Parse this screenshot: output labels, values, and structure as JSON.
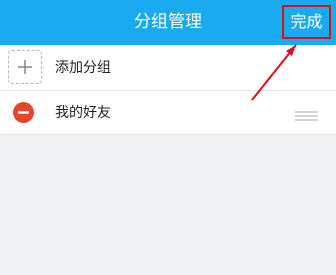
{
  "header": {
    "title": "分组管理",
    "done_label": "完成"
  },
  "groups": {
    "add_label": "添加分组",
    "items": [
      {
        "label": "我的好友"
      }
    ]
  },
  "colors": {
    "header_bg": "#1aaaf0",
    "remove_red": "#e4452d",
    "annotation_red": "#d7131a"
  }
}
